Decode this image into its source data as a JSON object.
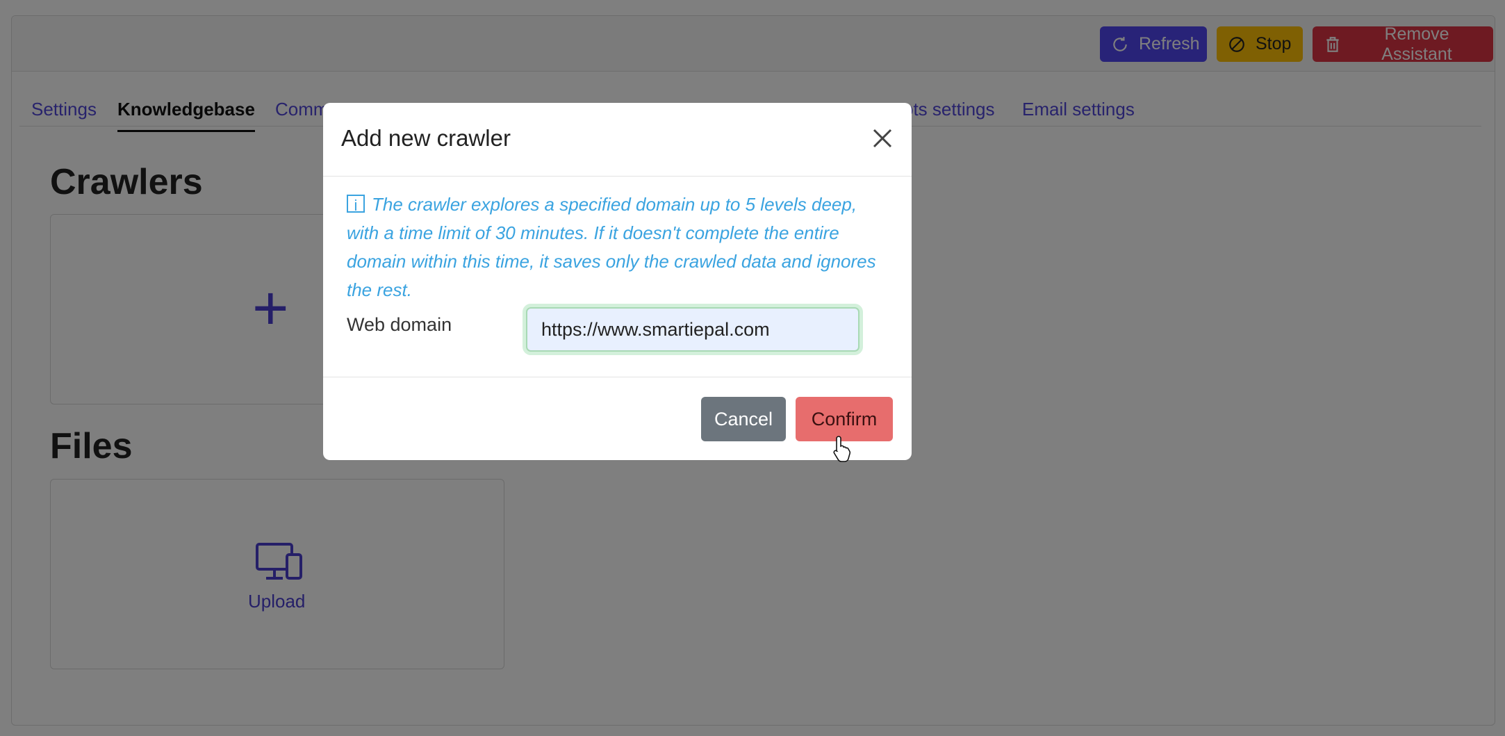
{
  "header": {
    "refresh_label": "Refresh",
    "stop_label": "Stop",
    "remove_label": "Remove Assistant"
  },
  "tabs": [
    {
      "label": "Settings"
    },
    {
      "label": "Knowledgebase"
    },
    {
      "label": "Comm"
    },
    {
      "label": "ots settings"
    },
    {
      "label": "Email settings"
    }
  ],
  "sections": {
    "crawlers_title": "Crawlers",
    "files_title": "Files",
    "upload_label": "Upload"
  },
  "modal": {
    "title": "Add new crawler",
    "info_text": "The crawler explores a specified domain up to 5 levels deep, with a time limit of 30 minutes. If it doesn't complete the entire domain within this time, it saves only the crawled data and ignores the rest.",
    "web_domain_label": "Web domain",
    "web_domain_value": "https://www.smartiepal.com",
    "cancel_label": "Cancel",
    "confirm_label": "Confirm"
  },
  "colors": {
    "primary": "#5146f0",
    "warning": "#ffc107",
    "danger": "#dc3545",
    "secondary": "#6c757d",
    "info": "#3aa3e0",
    "confirm": "#e76d6d"
  },
  "icons": [
    "refresh-icon",
    "stop-icon",
    "trash-icon",
    "plus-icon",
    "devices-icon",
    "info-icon",
    "close-icon",
    "hand-cursor-icon"
  ]
}
